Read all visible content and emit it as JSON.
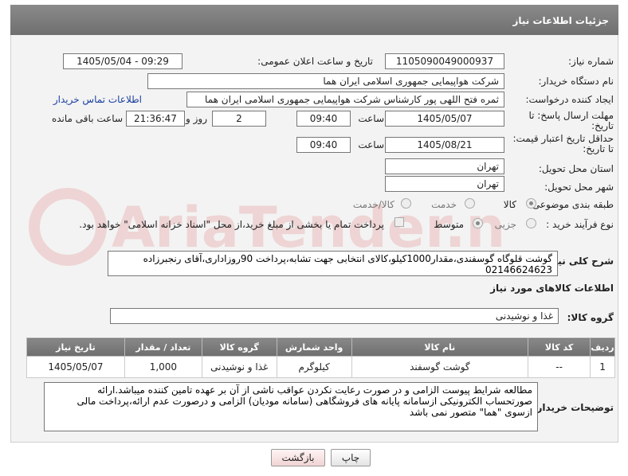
{
  "header": {
    "title": "جزئیات اطلاعات نیاز"
  },
  "fields": {
    "need_number_label": "شماره نیاز:",
    "need_number": "1105090049000937",
    "announce_label": "تاریخ و ساعت اعلان عمومی:",
    "announce_value": "1405/05/04 - 09:29",
    "buyer_org_label": "نام دستگاه خریدار:",
    "buyer_org": "شرکت هواپیمایی جمهوری اسلامی ایران هما",
    "requester_label": "ایجاد کننده درخواست:",
    "requester": "ثمره فتح اللهی پور کارشناس شرکت هواپیمایی جمهوری اسلامی ایران هما",
    "contact_link": "اطلاعات تماس خریدار",
    "deadline_label_1": "مهلت ارسال پاسخ: تا",
    "deadline_label_2": "تاریخ:",
    "deadline_date": "1405/05/07",
    "time_label": "ساعت",
    "deadline_time": "09:40",
    "days_value": "2",
    "days_label": "روز و",
    "remaining_time": "21:36:47",
    "remaining_label": "ساعت باقی مانده",
    "price_label_1": "حداقل تاریخ اعتبار قیمت:",
    "price_label_2": "تا تاریخ:",
    "price_date": "1405/08/21",
    "price_time": "09:40",
    "province_label": "استان محل تحویل:",
    "province": "تهران",
    "city_label": "شهر محل تحویل:",
    "city": "تهران",
    "category_label": "طبقه بندی موضوعی:",
    "category_options": [
      "کالا",
      "خدمت",
      "کالا/خدمت"
    ],
    "process_label": "نوع فرآیند خرید :",
    "process_options": [
      "جزیی",
      "متوسط"
    ],
    "payment_note": "پرداخت تمام یا بخشی از مبلغ خرید،از محل \"اسناد خزانه اسلامی\" خواهد بود.",
    "general_desc_label": "شرح کلی نیاز:",
    "general_desc": "گوشت قلوگاه گوسفندی،مقدار1000کیلو،کالای انتخابی جهت تشابه،پرداخت 90روزاداری،آقای رنجبرزاده 02146624623",
    "goods_info_title": "اطلاعات کالاهای مورد نیاز",
    "goods_group_label": "گروه کالا:",
    "goods_group": "غذا و نوشیدنی"
  },
  "table": {
    "headers": [
      "ردیف",
      "کد کالا",
      "نام کالا",
      "واحد شمارش",
      "گروه کالا",
      "تعداد / مقدار",
      "تاریخ نیاز"
    ],
    "rows": [
      [
        "1",
        "--",
        "گوشت گوسفند",
        "کیلوگرم",
        "غذا و نوشیدنی",
        "1,000",
        "1405/05/07"
      ]
    ]
  },
  "buyer_notes": {
    "label": "توضیحات خریدار:",
    "text": "مطالعه شرایط پیوست الزامی و در صورت رعایت نکردن عواقب ناشی از آن بر عهده تامین کننده میباشد.ارائه صورتحساب الکترونیکی ازسامانه پایانه های فروشگاهی (سامانه مودیان) الزامی و درصورت عدم ارائه،پرداخت مالی ازسوی \"هما\" متصور نمی باشد"
  },
  "buttons": {
    "print": "چاپ",
    "back": "بازگشت"
  },
  "watermark": {
    "text": "AriaTender.neT"
  }
}
